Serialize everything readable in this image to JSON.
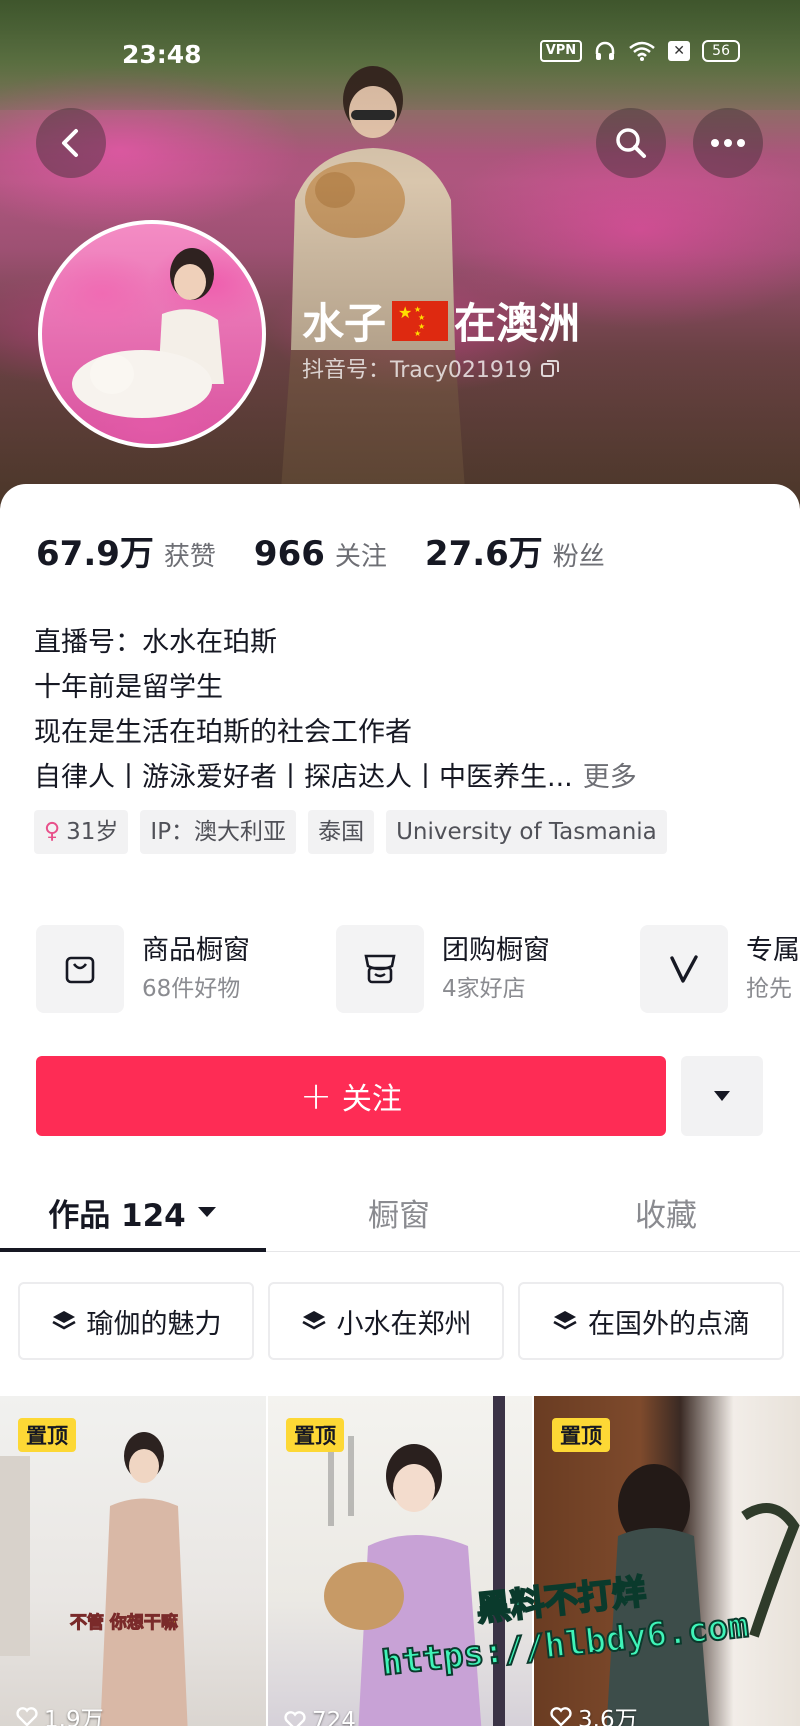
{
  "status_bar": {
    "time": "23:48",
    "vpn": "VPN",
    "battery": "56"
  },
  "profile": {
    "name_before_flag": "水子",
    "name_after_flag": "在澳洲",
    "douyin_id": "抖音号：Tracy021919"
  },
  "stats": [
    {
      "value": "67.9万",
      "label": "获赞"
    },
    {
      "value": "966",
      "label": "关注"
    },
    {
      "value": "27.6万",
      "label": "粉丝"
    }
  ],
  "bio": {
    "lines": [
      "直播号：水水在珀斯",
      "十年前是留学生",
      "现在是生活在珀斯的社会工作者",
      "自律人丨游泳爱好者丨探店达人丨中医养生..."
    ],
    "more": "更多"
  },
  "tags": [
    "31岁",
    "IP：澳大利亚",
    "泰国",
    "University of Tasmania"
  ],
  "shops": [
    {
      "title": "商品橱窗",
      "subtitle": "68件好物"
    },
    {
      "title": "团购橱窗",
      "subtitle": "4家好店"
    },
    {
      "title": "专属",
      "subtitle": "抢先"
    }
  ],
  "follow_button": "关注",
  "tabs": [
    "作品 124",
    "橱窗",
    "收藏"
  ],
  "collections": [
    "瑜伽的魅力",
    "小水在郑州",
    "在国外的点滴"
  ],
  "videos": [
    {
      "badge": "置顶",
      "likes": "1.9万",
      "caption": "不管 你想干嘛"
    },
    {
      "badge": "置顶",
      "likes": "724"
    },
    {
      "badge": "置顶",
      "likes": "3.6万"
    }
  ],
  "watermark": {
    "line1": "黑料不打烊",
    "line2": "https://hlbdy6.com"
  },
  "colors": {
    "accent": "#fe2c55",
    "pin_badge": "#fdd835",
    "watermark": "#3ff4b8"
  }
}
